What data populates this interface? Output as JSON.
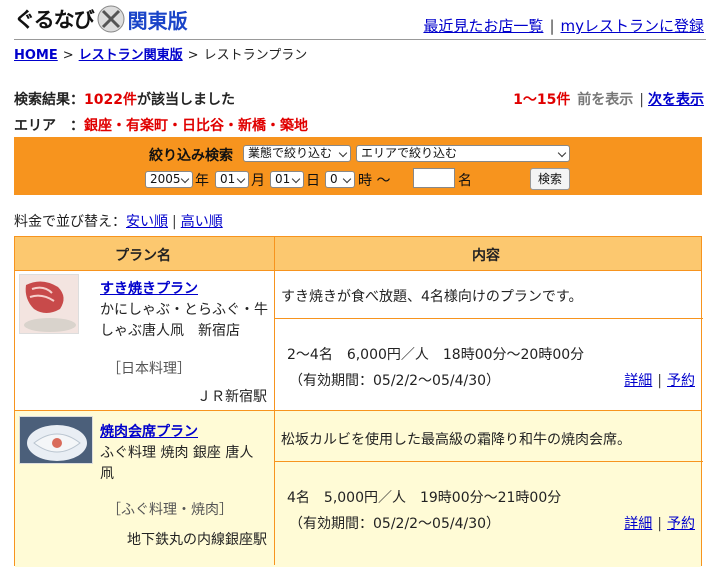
{
  "header": {
    "logo_text": "ぐるなび",
    "region_label": "関東版",
    "nav": {
      "recent_label": "最近見たお店一覧",
      "myrestaurant_label": "myレストランに登録"
    }
  },
  "breadcrumb": [
    "HOME",
    "レストラン関東版",
    "レストランプラン"
  ],
  "search": {
    "result_prefix": "検索結果：",
    "result_count": "1022件",
    "result_suffix": "が該当しました",
    "area_label": "エリア　：",
    "area_value": "銀座・有楽町・日比谷・新橋・築地"
  },
  "pager": {
    "range": "1〜15件",
    "prev_label": "前を表示",
    "next_label": "次を表示"
  },
  "filter": {
    "label": "絞り込み検索",
    "business_type": "業態で絞り込む",
    "area": "エリアで絞り込む",
    "year": "2005",
    "year_unit": "年",
    "month": "01",
    "month_unit": "月",
    "day": "01",
    "day_unit": "日",
    "hour": "0",
    "hour_unit": "時 〜",
    "people_unit": "名",
    "people_value": "",
    "search_button": "検索"
  },
  "sort": {
    "label": "料金で並び替え：",
    "cheap_label": "安い順",
    "expensive_label": "高い順"
  },
  "table": {
    "headers": [
      "プラン名",
      "内容"
    ],
    "rows": [
      {
        "plan_name": "すき焼きプラン",
        "shop": "かにしゃぶ・とらふぐ・牛しゃぶ唐人凧　新宿店",
        "genre": "［日本料理］",
        "station": "ＪＲ新宿駅",
        "description": "すき焼きが食べ放題、4名様向けのプランです。",
        "detail": "2〜4名　6,000円／人　18時00分〜20時00分",
        "validity": "（有効期間：05/2/2〜05/4/30）",
        "detail_link": "詳細",
        "reserve_link": "予約"
      },
      {
        "plan_name": "焼肉会席プラン",
        "shop": "ふぐ料理 焼肉 銀座 唐人凧",
        "genre": "［ふぐ料理・焼肉］",
        "station": "地下鉄丸の内線銀座駅",
        "description": "松坂カルビを使用した最高級の霜降り和牛の焼肉会席。",
        "detail": "4名　5,000円／人　19時00分〜21時00分",
        "validity": "（有効期間：05/2/2〜05/4/30）",
        "detail_link": "詳細",
        "reserve_link": "予約"
      }
    ]
  },
  "colors": {
    "accent_orange": "#f7941e",
    "header_orange": "#fcc86f",
    "alert_red": "#e00000",
    "link_blue": "#0000cc"
  }
}
